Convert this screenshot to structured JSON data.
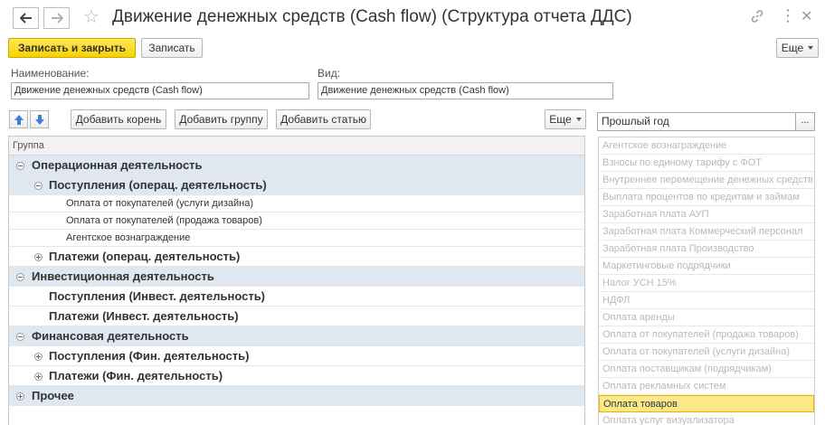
{
  "window": {
    "title": "Движение денежных средств (Cash flow) (Структура отчета ДДС)"
  },
  "toolbar": {
    "save_close_label": "Записать и закрыть",
    "save_label": "Записать",
    "more_label": "Еще"
  },
  "form": {
    "name_label": "Наименование:",
    "name_value": "Движение денежных средств (Cash flow)",
    "kind_label": "Вид:",
    "kind_value": "Движение денежных средств (Cash flow)"
  },
  "tree_toolbar": {
    "add_root_label": "Добавить корень",
    "add_group_label": "Добавить группу",
    "add_item_label": "Добавить статью",
    "more_label": "Еще"
  },
  "tree": {
    "column_header": "Группа",
    "rows": [
      {
        "level": 1,
        "label": "Операционная деятельность",
        "expander": "minus",
        "group": true
      },
      {
        "level": 2,
        "label": "Поступления (операц. деятельность)",
        "expander": "minus",
        "group": true
      },
      {
        "level": 3,
        "label": "Оплата от покупателей (услуги дизайна)",
        "expander": "none",
        "group": false
      },
      {
        "level": 3,
        "label": "Оплата от покупателей (продажа товаров)",
        "expander": "none",
        "group": false
      },
      {
        "level": 3,
        "label": "Агентское вознаграждение",
        "expander": "none",
        "group": false
      },
      {
        "level": 2,
        "label": "Платежи (операц. деятельность)",
        "expander": "plus",
        "group": false
      },
      {
        "level": 1,
        "label": "Инвестиционная деятельность",
        "expander": "minus",
        "group": true
      },
      {
        "level": 2,
        "label": "Поступления (Инвест. деятельность)",
        "expander": "none",
        "group": false
      },
      {
        "level": 2,
        "label": "Платежи (Инвест. деятельность)",
        "expander": "none",
        "group": false
      },
      {
        "level": 1,
        "label": "Финансовая деятельность",
        "expander": "minus",
        "group": true
      },
      {
        "level": 2,
        "label": "Поступления (Фин. деятельность)",
        "expander": "plus",
        "group": false
      },
      {
        "level": 2,
        "label": "Платежи (Фин. деятельность)",
        "expander": "plus",
        "group": false
      },
      {
        "level": 1,
        "label": "Прочее",
        "expander": "plus",
        "group": true
      }
    ]
  },
  "right_panel": {
    "period_value": "Прошлый год",
    "period_button": "...",
    "items": [
      "Агентское вознаграждение",
      "Взносы по единому тарифу с ФОТ",
      "Внутреннее перемещение денежных средств",
      "Выплата процентов по кредитам и займам",
      "Заработная плата АУП",
      "Заработная плата Коммерческий персонал",
      "Заработная плата Производство",
      "Маркетинговые подрядчики",
      "Налог УСН 15%",
      "НДФЛ",
      "Оплата аренды",
      "Оплата от покупателей (продажа товаров)",
      "Оплата от покупателей (услуги дизайна)",
      "Оплата поставщикам (подрядчикам)",
      "Оплата рекламных систем",
      "Оплата товаров",
      "Оплата услуг визуализатора"
    ],
    "selected_index": 15
  },
  "colors": {
    "primary_button": "#f6d200",
    "group_row": "#dfe7f1",
    "selected_item": "#fbe98a",
    "arrow_icon": "#3b7fd4"
  }
}
